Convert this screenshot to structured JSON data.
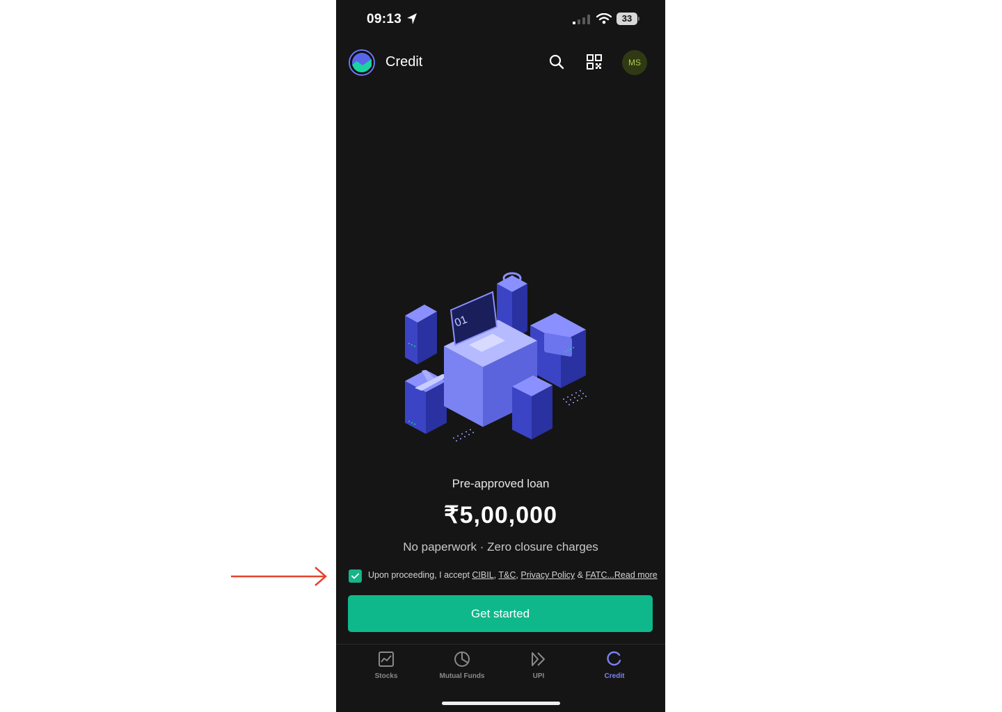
{
  "status_bar": {
    "time": "09:13",
    "battery": "33"
  },
  "header": {
    "title": "Credit",
    "avatar_initials": "MS"
  },
  "offer": {
    "label": "Pre-approved loan",
    "amount": "₹5,00,000",
    "tagline": "No paperwork · Zero closure charges"
  },
  "consent": {
    "checked": true,
    "prefix": "Upon proceeding, I accept ",
    "link_cibil": "CIBIL",
    "sep1": ", ",
    "link_tc": "T&C",
    "sep2": ", ",
    "link_privacy": "Privacy Policy",
    "sep3": " & ",
    "link_fatc": "FATC...",
    "link_read_more": "Read more"
  },
  "cta": {
    "label": "Get started"
  },
  "bottom_nav": {
    "items": [
      {
        "label": "Stocks",
        "icon": "chart-icon"
      },
      {
        "label": "Mutual Funds",
        "icon": "pie-icon"
      },
      {
        "label": "UPI",
        "icon": "upi-icon"
      },
      {
        "label": "Credit",
        "icon": "credit-icon",
        "active": true
      }
    ]
  },
  "colors": {
    "background": "#151515",
    "accent_green": "#0fb88a",
    "active_nav": "#7b83f2",
    "annotation_arrow": "#e5432e"
  }
}
